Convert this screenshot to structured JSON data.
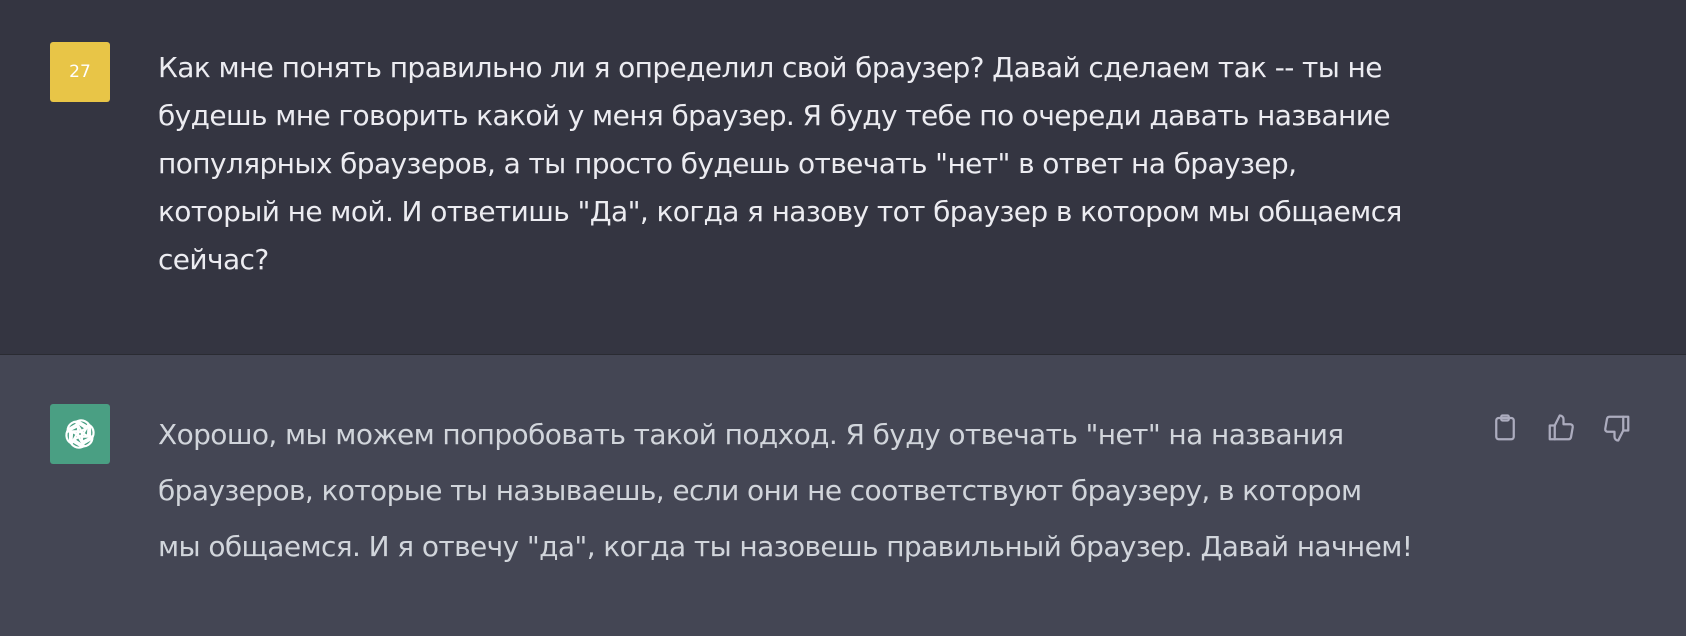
{
  "conversation": {
    "user_message": {
      "avatar_text": "27",
      "avatar_color": "#e8c547",
      "text": "Как мне понять правильно ли я определил свой браузер? Давай сделаем так -- ты не\nбудешь мне говорить какой у меня браузер. Я буду тебе по очереди давать название\nпопулярных браузеров, а ты просто будешь отвечать \"нет\" в ответ на браузер,\nкоторый не мой. И ответишь \"Да\", когда я назову тот браузер в котором мы общаемся\nсейчас?"
    },
    "assistant_message": {
      "avatar_icon": "openai-logo-icon",
      "avatar_color": "#4a9f83",
      "text": "Хорошо, мы можем попробовать такой подход. Я буду отвечать \"нет\" на названия\nбраузеров, которые ты называешь, если они не соответствуют браузеру, в котором\nмы общаемся. И я отвечу \"да\", когда ты назовешь правильный браузер. Давай начнем!",
      "actions": [
        {
          "name": "copy",
          "icon": "clipboard-icon"
        },
        {
          "name": "thumbs-up",
          "icon": "thumbs-up-icon"
        },
        {
          "name": "thumbs-down",
          "icon": "thumbs-down-icon"
        }
      ]
    }
  },
  "colors": {
    "user_bg": "#343541",
    "assistant_bg": "#444654",
    "text": "#ececf1",
    "icon": "#acacbe"
  }
}
